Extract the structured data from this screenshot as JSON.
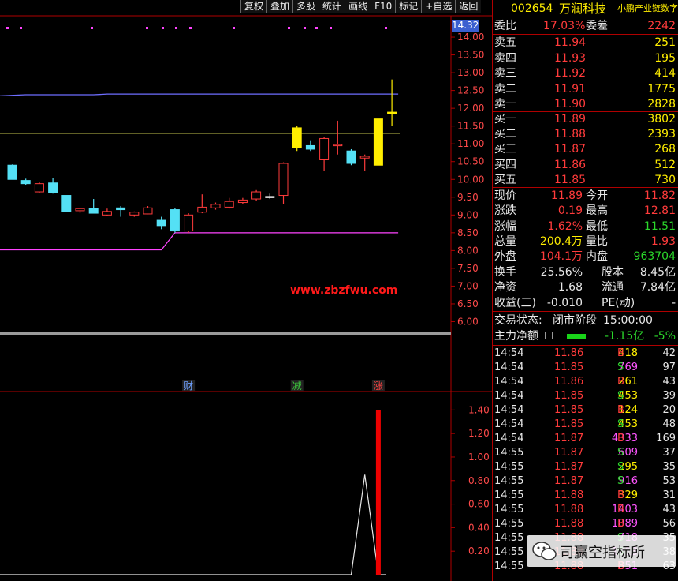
{
  "toolbar": [
    "复权",
    "叠加",
    "多股",
    "统计",
    "画线",
    "F10",
    "标记",
    "+自选",
    "返回"
  ],
  "price_box": "14.32",
  "price_axis": [
    "14.00",
    "13.50",
    "13.00",
    "12.50",
    "12.00",
    "11.50",
    "11.00",
    "10.50",
    "10.00",
    "9.50",
    "9.00",
    "8.50",
    "8.00",
    "7.50",
    "7.00",
    "6.50",
    "6.00"
  ],
  "indicator_axis": [
    "1.40",
    "1.20",
    "1.00",
    "0.80",
    "0.60",
    "0.40",
    "0.20"
  ],
  "chart_data": [
    {
      "type": "candlestick",
      "title": "",
      "candles": [
        {
          "open": 10.4,
          "high": 10.42,
          "low": 10.05,
          "close": 10.0,
          "color": "cyan"
        },
        {
          "open": 9.97,
          "high": 10.02,
          "low": 9.85,
          "close": 9.88,
          "color": "cyan"
        },
        {
          "open": 9.65,
          "high": 9.93,
          "low": 9.63,
          "close": 9.88,
          "color": "red"
        },
        {
          "open": 9.9,
          "high": 10.05,
          "low": 9.6,
          "close": 9.62,
          "color": "cyan"
        },
        {
          "open": 9.55,
          "high": 9.55,
          "low": 9.1,
          "close": 9.1,
          "color": "cyan"
        },
        {
          "open": 9.12,
          "high": 9.15,
          "low": 9.05,
          "close": 9.18,
          "color": "red"
        },
        {
          "open": 9.18,
          "high": 9.45,
          "low": 9.1,
          "close": 9.05,
          "color": "cyan"
        },
        {
          "open": 9.0,
          "high": 9.18,
          "low": 8.98,
          "close": 9.1,
          "color": "red"
        },
        {
          "open": 9.2,
          "high": 9.25,
          "low": 8.95,
          "close": 9.15,
          "color": "cyan"
        },
        {
          "open": 9.0,
          "high": 9.1,
          "low": 8.95,
          "close": 9.08,
          "color": "red"
        },
        {
          "open": 9.03,
          "high": 9.25,
          "low": 9.02,
          "close": 9.2,
          "color": "red"
        },
        {
          "open": 8.85,
          "high": 8.95,
          "low": 8.6,
          "close": 8.7,
          "color": "cyan"
        },
        {
          "open": 8.55,
          "high": 9.2,
          "low": 8.5,
          "close": 9.15,
          "color": "cyan"
        },
        {
          "open": 8.55,
          "high": 9.05,
          "low": 8.5,
          "close": 9.0,
          "color": "red"
        },
        {
          "open": 9.08,
          "high": 9.58,
          "low": 9.05,
          "close": 9.22,
          "color": "red"
        },
        {
          "open": 9.2,
          "high": 9.35,
          "low": 9.15,
          "close": 9.3,
          "color": "red"
        },
        {
          "open": 9.22,
          "high": 9.48,
          "low": 9.18,
          "close": 9.38,
          "color": "red"
        },
        {
          "open": 9.35,
          "high": 9.48,
          "low": 9.3,
          "close": 9.42,
          "color": "red"
        },
        {
          "open": 9.45,
          "high": 9.7,
          "low": 9.4,
          "close": 9.65,
          "color": "red"
        },
        {
          "open": 9.5,
          "high": 9.6,
          "low": 9.45,
          "close": 9.52,
          "color": "white"
        },
        {
          "open": 9.55,
          "high": 10.48,
          "low": 9.3,
          "close": 10.45,
          "color": "red"
        },
        {
          "open": 11.45,
          "high": 11.5,
          "low": 10.8,
          "close": 10.9,
          "color": "yellow"
        },
        {
          "open": 10.95,
          "high": 11.1,
          "low": 10.8,
          "close": 10.85,
          "color": "cyan"
        },
        {
          "open": 10.55,
          "high": 11.2,
          "low": 10.25,
          "close": 11.15,
          "color": "red"
        },
        {
          "open": 10.95,
          "high": 11.65,
          "low": 10.7,
          "close": 10.98,
          "color": "red"
        },
        {
          "open": 10.8,
          "high": 10.85,
          "low": 10.4,
          "close": 10.45,
          "color": "cyan"
        },
        {
          "open": 10.6,
          "high": 10.7,
          "low": 10.25,
          "close": 10.65,
          "color": "red"
        },
        {
          "open": 10.4,
          "high": 11.7,
          "low": 10.4,
          "close": 11.7,
          "color": "yellow"
        },
        {
          "open": 11.89,
          "high": 12.81,
          "low": 11.51,
          "close": 11.89,
          "color": "yellow"
        }
      ],
      "lines": [
        {
          "name": "",
          "color": "#6e6eff",
          "values": [
            12.35,
            12.38,
            12.38,
            12.38,
            12.38,
            12.38,
            12.38,
            12.4,
            12.4,
            12.4,
            12.4,
            12.4,
            12.4,
            12.4,
            12.4,
            12.4,
            12.4,
            12.4,
            12.4,
            12.4,
            12.4,
            12.4,
            12.4,
            12.4,
            12.4,
            12.4,
            12.4,
            12.4,
            12.4
          ]
        },
        {
          "name": "",
          "color": "#ffff66",
          "values": [
            11.3,
            11.3,
            11.3,
            11.3,
            11.3,
            11.3,
            11.3,
            11.3,
            11.3,
            11.3,
            11.3,
            11.3,
            11.3,
            11.3,
            11.3,
            11.3,
            11.3,
            11.3,
            11.3,
            11.3,
            11.3,
            11.3,
            11.3,
            11.3,
            11.3,
            11.3,
            11.3,
            11.3,
            11.3
          ]
        },
        {
          "name": "",
          "color": "#ff44ff",
          "values": [
            8.02,
            8.02,
            8.02,
            8.02,
            8.02,
            8.02,
            8.02,
            8.02,
            8.02,
            8.02,
            8.02,
            8.02,
            8.5,
            8.5,
            8.5,
            8.5,
            8.5,
            8.5,
            8.5,
            8.5,
            8.5,
            8.5,
            8.5,
            8.5,
            8.5,
            8.5,
            8.5,
            8.5,
            8.5
          ]
        }
      ],
      "ylim": [
        5.7,
        14.6
      ]
    },
    {
      "type": "bar",
      "title": "",
      "bar_index": 28,
      "bar_value": 1.4,
      "line_values": [
        0,
        0,
        0,
        0,
        0,
        0,
        0,
        0,
        0,
        0,
        0,
        0,
        0,
        0,
        0,
        0,
        0,
        0,
        0,
        0,
        0,
        0,
        0,
        0,
        0,
        0,
        0.85,
        0
      ],
      "ylim": [
        0,
        1.55
      ]
    }
  ],
  "dots_top": [
    8,
    25,
    115,
    185,
    205,
    222,
    240,
    295,
    365,
    385,
    400,
    418,
    488
  ],
  "markers": [
    {
      "label": "财",
      "color": "#6ea0ff",
      "index": 13
    },
    {
      "label": "减",
      "color": "#3ecf3e",
      "index": 21
    },
    {
      "label": "涨",
      "color": "#ff4444",
      "index": 27
    }
  ],
  "watermark_site": "www.zbzfwu.com",
  "stock": {
    "code": "002654",
    "name": "万润科技",
    "sector": "小鹏产业链数字"
  },
  "wb": {
    "label": "委比",
    "value": "17.03%",
    "diff_label": "委差",
    "diff": "2242"
  },
  "asks": [
    {
      "label": "卖五",
      "price": "11.94",
      "vol": "251"
    },
    {
      "label": "卖四",
      "price": "11.93",
      "vol": "195"
    },
    {
      "label": "卖三",
      "price": "11.92",
      "vol": "414"
    },
    {
      "label": "卖二",
      "price": "11.91",
      "vol": "1775"
    },
    {
      "label": "卖一",
      "price": "11.90",
      "vol": "2828"
    }
  ],
  "bids": [
    {
      "label": "买一",
      "price": "11.89",
      "vol": "3802"
    },
    {
      "label": "买二",
      "price": "11.88",
      "vol": "2393"
    },
    {
      "label": "买三",
      "price": "11.87",
      "vol": "268"
    },
    {
      "label": "买四",
      "price": "11.86",
      "vol": "512"
    },
    {
      "label": "买五",
      "price": "11.85",
      "vol": "730"
    }
  ],
  "quote": [
    {
      "l1": "现价",
      "v1": "11.89",
      "c1": "red",
      "l2": "今开",
      "v2": "11.82",
      "c2": "red"
    },
    {
      "l1": "涨跌",
      "v1": "0.19",
      "c1": "red",
      "l2": "最高",
      "v2": "12.81",
      "c2": "red"
    },
    {
      "l1": "涨幅",
      "v1": "1.62%",
      "c1": "red",
      "l2": "最低",
      "v2": "11.51",
      "c2": "green"
    },
    {
      "l1": "总量",
      "v1": "200.4万",
      "c1": "yellow",
      "l2": "量比",
      "v2": "1.93",
      "c2": "red"
    },
    {
      "l1": "外盘",
      "v1": "104.1万",
      "c1": "red",
      "l2": "内盘",
      "v2": "963704",
      "c2": "green"
    }
  ],
  "quote2": [
    {
      "l1": "换手",
      "v1": "25.56%",
      "c1": "white",
      "l2": "股本",
      "v2": "8.45亿",
      "c2": "white"
    },
    {
      "l1": "净资",
      "v1": "1.68",
      "c1": "white",
      "l2": "流通",
      "v2": "7.84亿",
      "c2": "white"
    },
    {
      "l1": "收益(三)",
      "v1": "-0.010",
      "c1": "white",
      "l2": "PE(动)",
      "v2": "-",
      "c2": "white"
    }
  ],
  "status": {
    "label": "交易状态:",
    "value": "闭市阶段",
    "time": "15:00:00"
  },
  "main_flow": {
    "label": "主力净额",
    "value": "-1.15亿",
    "pct": "-5%"
  },
  "ticks": [
    {
      "t": "14:54",
      "p": "11.86",
      "v": "418",
      "vc": "yellow",
      "d": "B",
      "n": "42"
    },
    {
      "t": "14:54",
      "p": "11.85",
      "v": "769",
      "vc": "magenta",
      "d": "S",
      "n": "97"
    },
    {
      "t": "14:54",
      "p": "11.86",
      "v": "261",
      "vc": "yellow",
      "d": "B",
      "n": "43"
    },
    {
      "t": "14:54",
      "p": "11.85",
      "v": "453",
      "vc": "yellow",
      "d": "S",
      "n": "39"
    },
    {
      "t": "14:54",
      "p": "11.85",
      "v": "124",
      "vc": "yellow",
      "d": "B",
      "n": "20"
    },
    {
      "t": "14:54",
      "p": "11.85",
      "v": "453",
      "vc": "yellow",
      "d": "S",
      "n": "48"
    },
    {
      "t": "14:54",
      "p": "11.87",
      "v": "4333",
      "vc": "magenta",
      "d": "B",
      "n": "169"
    },
    {
      "t": "14:55",
      "p": "11.87",
      "v": "609",
      "vc": "magenta",
      "d": "S",
      "n": "37"
    },
    {
      "t": "14:55",
      "p": "11.87",
      "v": "295",
      "vc": "yellow",
      "d": "S",
      "n": "35"
    },
    {
      "t": "14:55",
      "p": "11.87",
      "v": "916",
      "vc": "magenta",
      "d": "S",
      "n": "53"
    },
    {
      "t": "14:55",
      "p": "11.88",
      "v": "329",
      "vc": "yellow",
      "d": "B",
      "n": "31"
    },
    {
      "t": "14:55",
      "p": "11.88",
      "v": "1403",
      "vc": "magenta",
      "d": "B",
      "n": "43"
    },
    {
      "t": "14:55",
      "p": "11.88",
      "v": "1089",
      "vc": "magenta",
      "d": "B",
      "n": "56"
    },
    {
      "t": "14:55",
      "p": "11.88",
      "v": "718",
      "vc": "magenta",
      "d": "S",
      "n": "35"
    },
    {
      "t": "14:55",
      "p": "11.88",
      "v": "1213",
      "vc": "magenta",
      "d": "S",
      "n": "38"
    },
    {
      "t": "14:55",
      "p": "11.88",
      "v": "851",
      "vc": "magenta",
      "d": "B",
      "n": "63"
    }
  ],
  "brand": "司赢空指标所"
}
